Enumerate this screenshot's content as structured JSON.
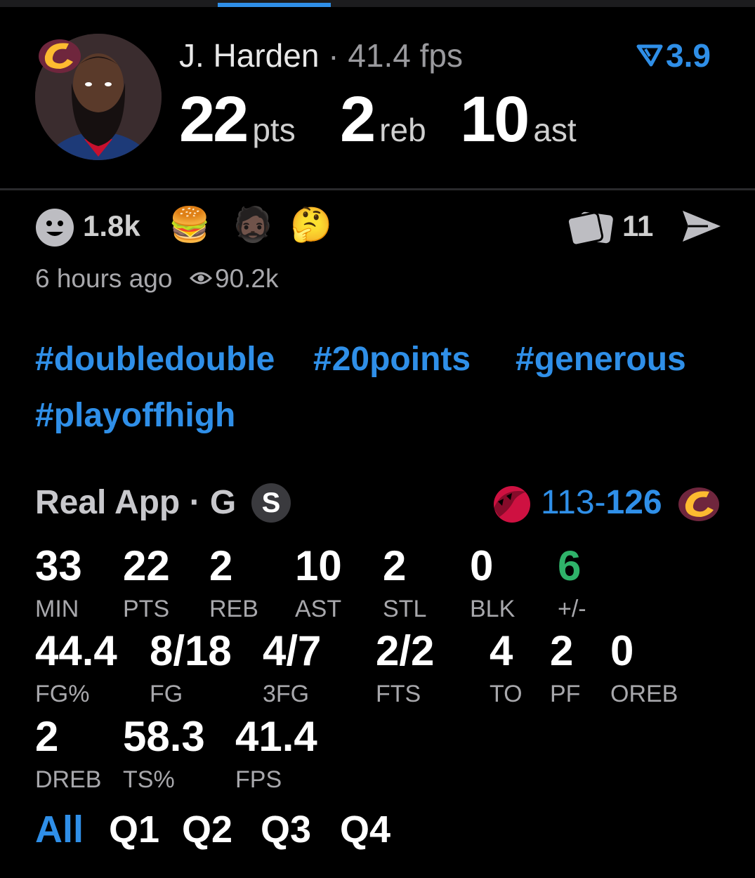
{
  "player": {
    "name": "J. Harden",
    "separator": "·",
    "fps_label": "41.4 fps",
    "rating": "3.9",
    "pts": "22",
    "pts_unit": "pts",
    "reb": "2",
    "reb_unit": "reb",
    "ast": "10",
    "ast_unit": "ast"
  },
  "reactions": {
    "count": "1.8k",
    "emojis": [
      "🍔",
      "🧔🏿",
      "🤔"
    ],
    "comments": "11"
  },
  "meta": {
    "time": "6 hours ago",
    "views": "90.2k"
  },
  "tags": [
    "#doubledouble",
    "#20points",
    "#generous",
    "#playoffhigh"
  ],
  "game": {
    "source": "Real App · G",
    "badge": "S",
    "score_left": "113-",
    "score_right": "126"
  },
  "stats": [
    {
      "value": "33",
      "label": "MIN"
    },
    {
      "value": "22",
      "label": "PTS"
    },
    {
      "value": "2",
      "label": "REB"
    },
    {
      "value": "10",
      "label": "AST"
    },
    {
      "value": "2",
      "label": "STL"
    },
    {
      "value": "0",
      "label": "BLK"
    },
    {
      "value": "6",
      "label": "+/-"
    },
    {
      "value": "44.4",
      "label": "FG%"
    },
    {
      "value": "8/18",
      "label": "FG"
    },
    {
      "value": "4/7",
      "label": "3FG"
    },
    {
      "value": "2/2",
      "label": "FTS"
    },
    {
      "value": "4",
      "label": "TO"
    },
    {
      "value": "2",
      "label": "PF"
    },
    {
      "value": "0",
      "label": "OREB"
    },
    {
      "value": "2",
      "label": "DREB"
    },
    {
      "value": "58.3",
      "label": "TS%"
    },
    {
      "value": "41.4",
      "label": "FPS"
    }
  ],
  "tabs": [
    "All",
    "Q1",
    "Q2",
    "Q3",
    "Q4"
  ],
  "colors": {
    "accent": "#2f8fe8",
    "positive": "#2fb36a",
    "background": "#000000"
  }
}
